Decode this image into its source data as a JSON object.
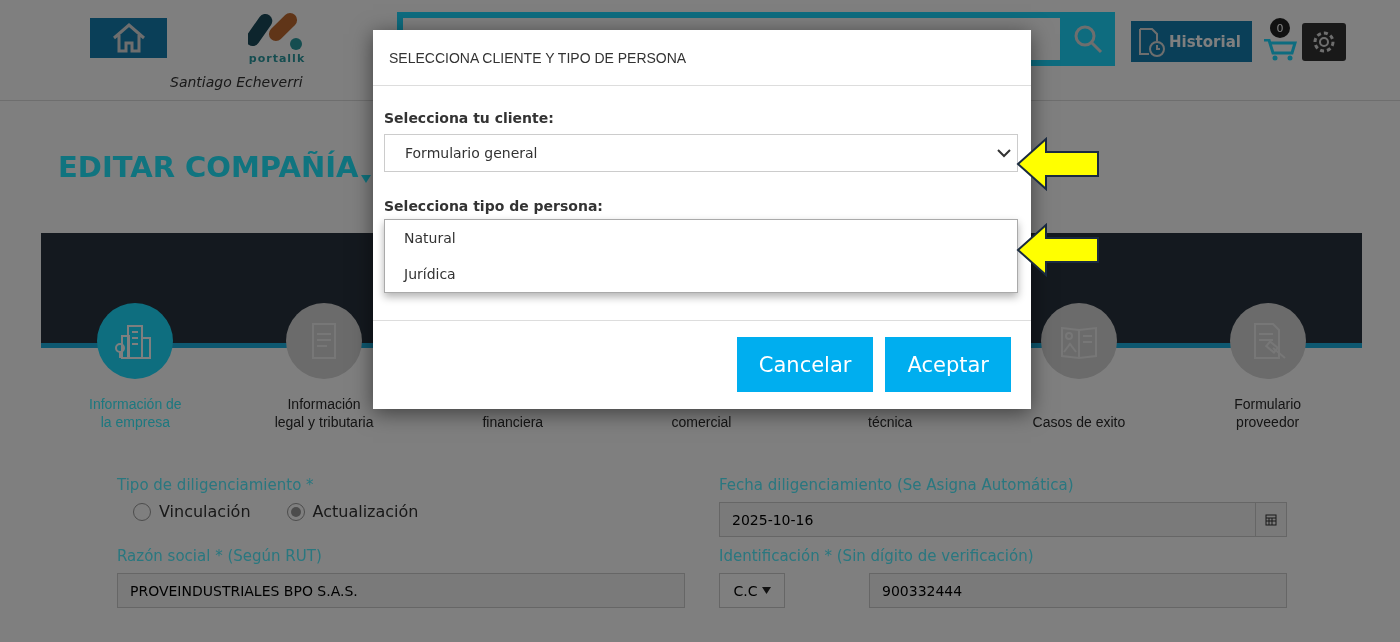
{
  "header": {
    "user_name": "Santiago Echeverri",
    "logo_text": "portallk",
    "history_button": "Historial",
    "cart_count": "0"
  },
  "page_title": "EDITAR COMPAÑÍA",
  "steps": [
    {
      "label": "Información de la empresa",
      "active": true
    },
    {
      "label": "Información legal y tributaria",
      "active": false
    },
    {
      "label": "financiera",
      "active": false
    },
    {
      "label": "comercial",
      "active": false
    },
    {
      "label": "técnica",
      "active": false
    },
    {
      "label": "Casos de exito",
      "active": false
    },
    {
      "label": "Formulario proveedor",
      "active": false
    }
  ],
  "form": {
    "diligence_type": {
      "label": "Tipo de diligenciamiento *",
      "options": [
        {
          "label": "Vinculación",
          "selected": false
        },
        {
          "label": "Actualización",
          "selected": true
        }
      ]
    },
    "date": {
      "label": "Fecha diligenciamiento (Se Asigna Automática)",
      "value": "2025-10-16"
    },
    "company_name": {
      "label": "Razón social * (Según RUT)",
      "value": "PROVEINDUSTRIALES BPO S.A.S."
    },
    "identification": {
      "label": "Identificación * (Sin dígito de verificación)",
      "doc_type": "C.C",
      "value": "900332444"
    }
  },
  "modal": {
    "title": "SELECCIONA CLIENTE Y TIPO DE PERSONA",
    "fields": [
      {
        "label": "Selecciona tu cliente:",
        "value": "Formulario general",
        "expanded": false
      },
      {
        "label": "Selecciona tipo de persona:",
        "expanded": true,
        "options": [
          {
            "label": "Natural",
            "selected": false
          },
          {
            "label": "Jurídica",
            "selected": false
          }
        ]
      }
    ],
    "buttons": [
      "Cancelar",
      "Aceptar"
    ]
  }
}
